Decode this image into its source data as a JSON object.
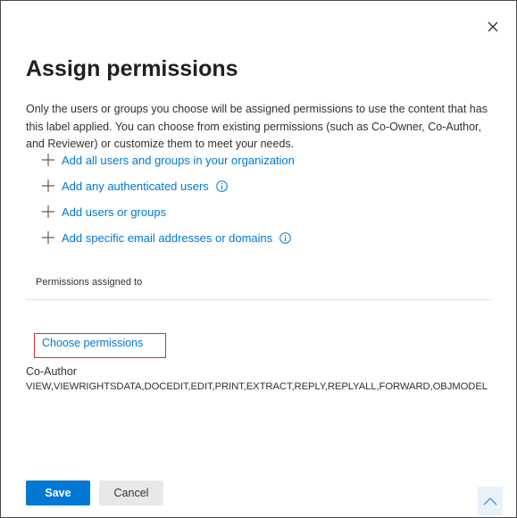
{
  "dialog": {
    "title": "Assign permissions",
    "description": "Only the users or groups you choose will be assigned permissions to use the content that has this label applied. You can choose from existing permissions (such as Co-Owner, Co-Author, and Reviewer) or customize them to meet your needs."
  },
  "add_options": [
    {
      "label": "Add all users and groups in your organization",
      "icon": "plus-icon"
    },
    {
      "label": "Add any authenticated users",
      "icon": "plus-icon",
      "info": "info-icon"
    },
    {
      "label": "Add users or groups",
      "icon": "plus-icon"
    },
    {
      "label": "Add specific email addresses or domains",
      "icon": "plus-icon",
      "info": "info-icon"
    }
  ],
  "permissions": {
    "assigned_to_label": "Permissions assigned to",
    "choose_link": "Choose permissions",
    "role": "Co-Author",
    "rights": "VIEW,VIEWRIGHTSDATA,DOCEDIT,EDIT,PRINT,EXTRACT,REPLY,REPLYALL,FORWARD,OBJMODEL"
  },
  "footer": {
    "save_label": "Save",
    "cancel_label": "Cancel"
  },
  "colors": {
    "accent": "#0078d4",
    "highlight_border": "#d13438"
  }
}
